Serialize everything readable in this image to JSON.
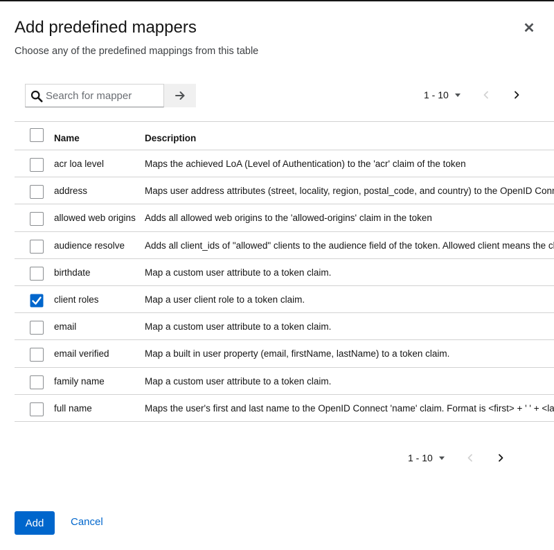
{
  "modal": {
    "title": "Add predefined mappers",
    "subtitle": "Choose any of the predefined mappings from this table",
    "close_icon": "close-icon"
  },
  "search": {
    "placeholder": "Search for mapper",
    "value": "",
    "search_icon": "search-icon",
    "submit_icon": "arrow-right-icon"
  },
  "pagination": {
    "range": "1 - 10",
    "prev_icon": "chevron-left-icon",
    "next_icon": "chevron-right-icon",
    "prev_disabled": true
  },
  "table": {
    "columns": [
      "Name",
      "Description"
    ],
    "select_all_checked": false,
    "rows": [
      {
        "name": "acr loa level",
        "description": "Maps the achieved LoA (Level of Authentication) to the 'acr' claim of the token",
        "checked": false
      },
      {
        "name": "address",
        "description": "Maps user address attributes (street, locality, region, postal_code, and country) to the OpenID Connect 'address' claim.",
        "checked": false
      },
      {
        "name": "allowed web origins",
        "description": "Adds all allowed web origins to the 'allowed-origins' claim in the token",
        "checked": false
      },
      {
        "name": "audience resolve",
        "description": "Adds all client_ids of \"allowed\" clients to the audience field of the token. Allowed client means the client",
        "checked": false
      },
      {
        "name": "birthdate",
        "description": "Map a custom user attribute to a token claim.",
        "checked": false
      },
      {
        "name": "client roles",
        "description": "Map a user client role to a token claim.",
        "checked": true
      },
      {
        "name": "email",
        "description": "Map a custom user attribute to a token claim.",
        "checked": false
      },
      {
        "name": "email verified",
        "description": "Map a built in user property (email, firstName, lastName) to a token claim.",
        "checked": false
      },
      {
        "name": "family name",
        "description": "Map a custom user attribute to a token claim.",
        "checked": false
      },
      {
        "name": "full name",
        "description": "Maps the user's first and last name to the OpenID Connect 'name' claim. Format is <first> + ' ' + <last>",
        "checked": false
      }
    ]
  },
  "footer": {
    "add_label": "Add",
    "cancel_label": "Cancel"
  },
  "colors": {
    "primary": "#0066cc",
    "text": "#151515",
    "border": "#d2d2d2"
  }
}
